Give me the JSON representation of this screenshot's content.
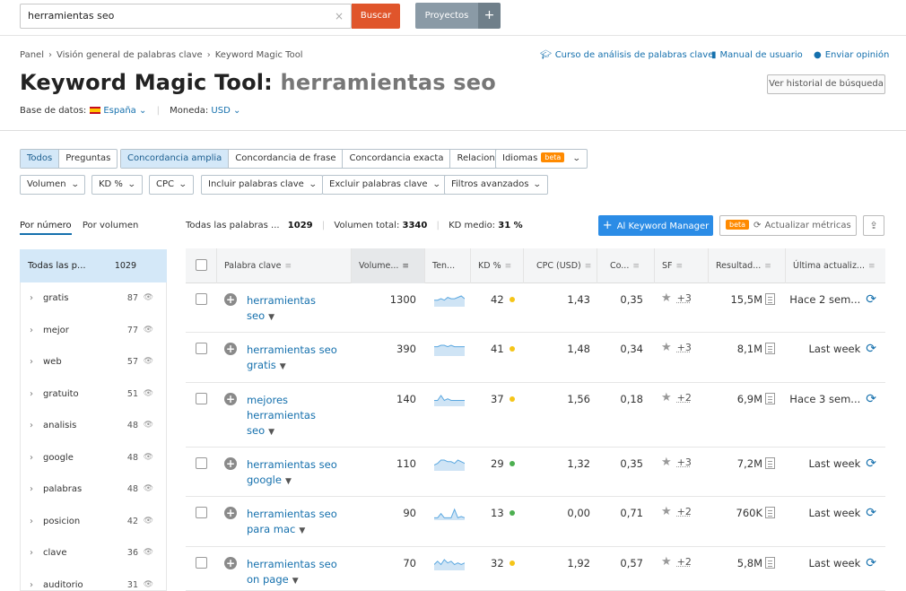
{
  "search": {
    "value": "herramientas seo",
    "clear_icon": "×",
    "button_label": "Buscar"
  },
  "projects": {
    "label": "Proyectos",
    "plus": "+"
  },
  "breadcrumb": [
    "Panel",
    "Visión general de palabras clave",
    "Keyword Magic Tool"
  ],
  "links": {
    "course": "Curso de análisis de palabras clave",
    "manual": "Manual de usuario",
    "feedback": "Enviar opinión"
  },
  "title": {
    "tool": "Keyword Magic Tool:",
    "query": "herramientas seo"
  },
  "history_button": "Ver historial de búsqueda",
  "database": {
    "label": "Base de datos:",
    "value": "España",
    "currency_label": "Moneda:",
    "currency_value": "USD"
  },
  "filters": {
    "type_tabs": [
      "Todos",
      "Preguntas"
    ],
    "match_tabs": [
      "Concordancia amplia",
      "Concordancia de frase",
      "Concordancia exacta",
      "Relacionadas"
    ],
    "languages": "Idiomas",
    "beta": "beta",
    "dropdowns": [
      "Volumen",
      "KD %",
      "CPC",
      "Incluir palabras clave",
      "Excluir palabras clave",
      "Filtros avanzados"
    ]
  },
  "sidebar": {
    "tabs": [
      "Por número",
      "Por volumen"
    ],
    "all_label": "Todas las p...",
    "all_count": "1029",
    "items": [
      {
        "label": "gratis",
        "count": "87"
      },
      {
        "label": "mejor",
        "count": "77"
      },
      {
        "label": "web",
        "count": "57"
      },
      {
        "label": "gratuito",
        "count": "51"
      },
      {
        "label": "analisis",
        "count": "48"
      },
      {
        "label": "google",
        "count": "48"
      },
      {
        "label": "palabras",
        "count": "48"
      },
      {
        "label": "posicion",
        "count": "42"
      },
      {
        "label": "clave",
        "count": "36"
      },
      {
        "label": "auditorio",
        "count": "31"
      }
    ]
  },
  "summary": {
    "all_label": "Todas las palabras ...",
    "all_value": "1029",
    "volume_label": "Volumen total:",
    "volume_value": "3340",
    "kd_label": "KD medio:",
    "kd_value": "31 %"
  },
  "actions": {
    "km_button": "Al Keyword Manager",
    "beta": "beta",
    "update": "Actualizar métricas"
  },
  "columns": [
    "Palabra clave",
    "Volume...",
    "Ten...",
    "KD %",
    "CPC (USD)",
    "Co...",
    "SF",
    "Resultad...",
    "Última actualiz..."
  ],
  "rows": [
    {
      "keyword": "herramientas seo",
      "volume": "1300",
      "kd": "42",
      "kd_color": "#f5c518",
      "cpc": "1,43",
      "com": "0,35",
      "sf": "+3",
      "results": "15,5M",
      "updated": "Hace 2 sem...",
      "trend": [
        4,
        4,
        5,
        4,
        6,
        5,
        5,
        6,
        7,
        5
      ]
    },
    {
      "keyword": "herramientas seo gratis",
      "volume": "390",
      "kd": "41",
      "kd_color": "#f5c518",
      "cpc": "1,48",
      "com": "0,34",
      "sf": "+3",
      "results": "8,1M",
      "updated": "Last week",
      "trend": [
        6,
        6,
        7,
        7,
        6,
        7,
        6,
        6,
        6,
        6
      ]
    },
    {
      "keyword": "mejores herramientas seo",
      "volume": "140",
      "kd": "37",
      "kd_color": "#f5c518",
      "cpc": "1,56",
      "com": "0,18",
      "sf": "+2",
      "results": "6,9M",
      "updated": "Hace 3 sem...",
      "trend": [
        3,
        3,
        6,
        3,
        4,
        3,
        3,
        3,
        3,
        3
      ]
    },
    {
      "keyword": "herramientas seo google",
      "volume": "110",
      "kd": "29",
      "kd_color": "#4caf50",
      "cpc": "1,32",
      "com": "0,35",
      "sf": "+3",
      "results": "7,2M",
      "updated": "Last week",
      "trend": [
        3,
        4,
        6,
        6,
        5,
        5,
        4,
        6,
        5,
        4
      ]
    },
    {
      "keyword": "herramientas seo para mac",
      "volume": "90",
      "kd": "13",
      "kd_color": "#4caf50",
      "cpc": "0,00",
      "com": "0,71",
      "sf": "+2",
      "results": "760K",
      "updated": "Last week",
      "trend": [
        1,
        1,
        4,
        1,
        1,
        1,
        7,
        1,
        2,
        1
      ]
    },
    {
      "keyword": "herramientas seo on page",
      "volume": "70",
      "kd": "32",
      "kd_color": "#f5c518",
      "cpc": "1,92",
      "com": "0,57",
      "sf": "+2",
      "results": "5,8M",
      "updated": "Last week",
      "trend": [
        3,
        5,
        3,
        6,
        4,
        5,
        3,
        4,
        3,
        4
      ]
    }
  ],
  "colors": {
    "brand_orange": "#e0552b",
    "link_blue": "#1570ad",
    "primary_button": "#2b8ce6",
    "selected_bg": "#d4e8f8"
  }
}
